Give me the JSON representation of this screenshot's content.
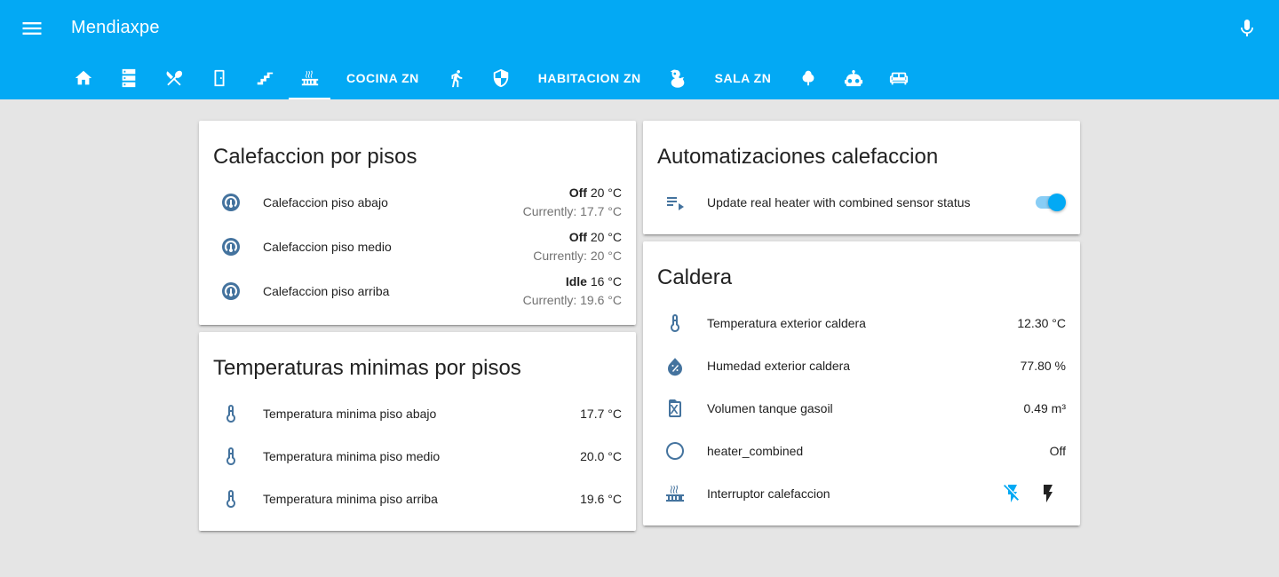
{
  "header": {
    "title": "Mendiaxpe",
    "menu_icon": "menu-icon",
    "mic_icon": "microphone-icon"
  },
  "tabs": [
    {
      "type": "icon",
      "icon": "home-icon"
    },
    {
      "type": "icon",
      "icon": "server-icon"
    },
    {
      "type": "icon",
      "icon": "silverware-icon"
    },
    {
      "type": "icon",
      "icon": "door-icon"
    },
    {
      "type": "icon",
      "icon": "stairs-icon"
    },
    {
      "type": "icon",
      "icon": "radiator-icon",
      "active": true
    },
    {
      "type": "text",
      "label": "COCINA ZN"
    },
    {
      "type": "icon",
      "icon": "walk-icon"
    },
    {
      "type": "icon",
      "icon": "security-shield-icon"
    },
    {
      "type": "text",
      "label": "HABITACION ZN"
    },
    {
      "type": "icon",
      "icon": "duck-icon"
    },
    {
      "type": "text",
      "label": "SALA ZN"
    },
    {
      "type": "icon",
      "icon": "tree-icon"
    },
    {
      "type": "icon",
      "icon": "robot-icon"
    },
    {
      "type": "icon",
      "icon": "sofa-icon"
    }
  ],
  "cards": {
    "calefaccion": {
      "title": "Calefaccion por pisos",
      "rows": [
        {
          "name": "Calefaccion piso abajo",
          "state": "Off",
          "target": "20 °C",
          "current": "Currently: 17.7 °C"
        },
        {
          "name": "Calefaccion piso medio",
          "state": "Off",
          "target": "20 °C",
          "current": "Currently: 20 °C"
        },
        {
          "name": "Calefaccion piso arriba",
          "state": "Idle",
          "target": "16 °C",
          "current": "Currently: 19.6 °C"
        }
      ]
    },
    "minimas": {
      "title": "Temperaturas minimas por pisos",
      "rows": [
        {
          "name": "Temperatura minima piso abajo",
          "value": "17.7 °C"
        },
        {
          "name": "Temperatura minima piso medio",
          "value": "20.0 °C"
        },
        {
          "name": "Temperatura minima piso arriba",
          "value": "19.6 °C"
        }
      ]
    },
    "automatizaciones": {
      "title": "Automatizaciones calefaccion",
      "rows": [
        {
          "name": "Update real heater with combined sensor status",
          "toggle_on": true
        }
      ]
    },
    "caldera": {
      "title": "Caldera",
      "rows": [
        {
          "name": "Temperatura exterior caldera",
          "value": "12.30 °C"
        },
        {
          "name": "Humedad exterior caldera",
          "value": "77.80 %"
        },
        {
          "name": "Volumen tanque gasoil",
          "value": "0.49 m³"
        },
        {
          "name": "heater_combined",
          "value": "Off"
        },
        {
          "name": "Interruptor calefaccion",
          "off_icon": "flash-off-icon",
          "on_icon": "flash-icon"
        }
      ]
    }
  },
  "colors": {
    "header": "#03a9f4",
    "icon": "#44739e",
    "background": "#e5e5e5"
  }
}
